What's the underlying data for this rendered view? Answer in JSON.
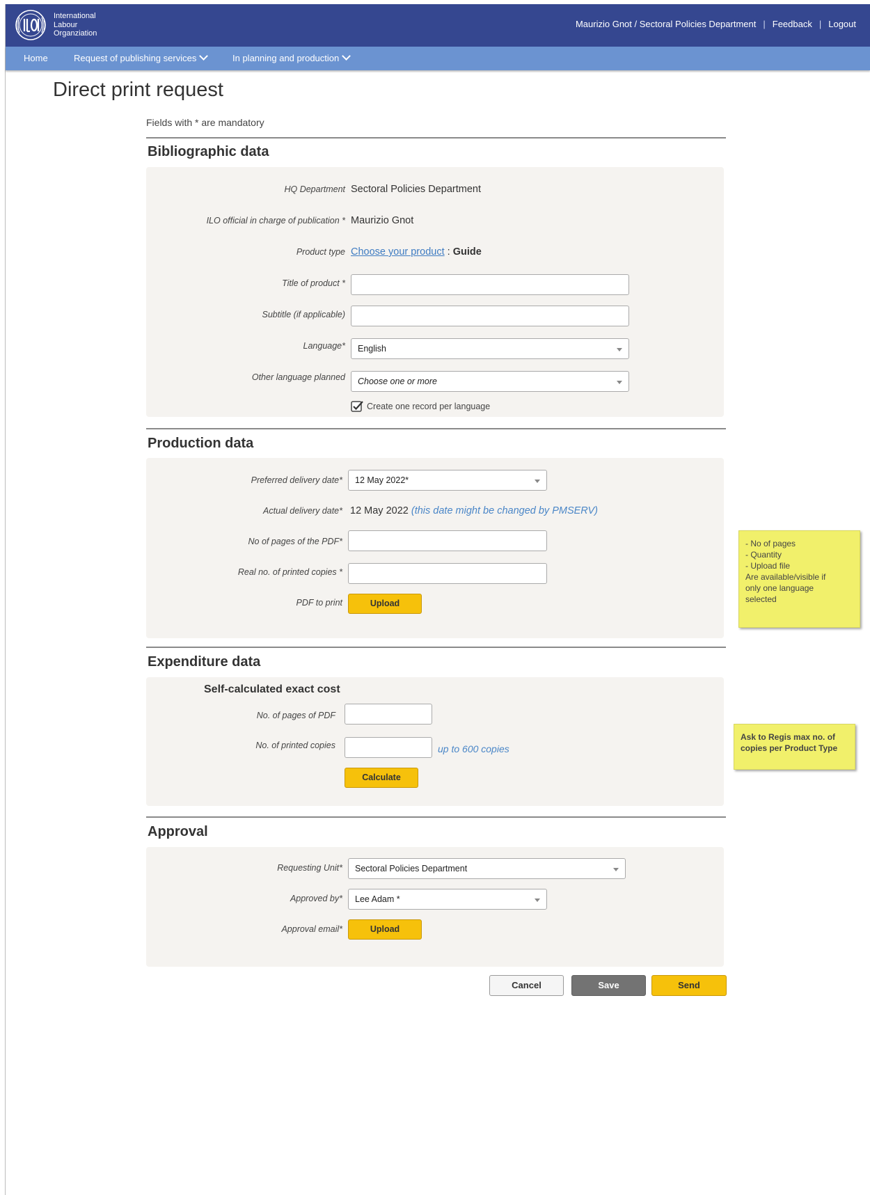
{
  "header": {
    "org_line1": "International",
    "org_line2": "Labour",
    "org_line3": "Organziation",
    "user": "Maurizio Gnot / Sectoral Policies Department",
    "feedback": "Feedback",
    "logout": "Logout",
    "separator": "|"
  },
  "nav": {
    "home": "Home",
    "request": "Request of publishing services",
    "planning": "In planning and production"
  },
  "page": {
    "title": "Direct print request",
    "mandatory_note": "Fields with * are mandatory"
  },
  "bibliographic": {
    "title": "Bibliographic data",
    "hq_label": "HQ Department",
    "hq_value": "Sectoral Policies Department",
    "official_label": "ILO official in charge of publication *",
    "official_value": "Maurizio Gnot",
    "product_label": "Product type",
    "product_link": "Choose your product",
    "product_sep": " : ",
    "product_value": "Guide",
    "title_label": "Title of product *",
    "title_value": "",
    "subtitle_label": "Subtitle (if applicable)",
    "subtitle_value": "",
    "language_label": "Language*",
    "language_value": "English",
    "other_lang_label": "Other language planned",
    "other_lang_placeholder": "Choose one or more",
    "record_checkbox_label": "Create one record per language",
    "record_checked": true
  },
  "production": {
    "title": "Production data",
    "pref_date_label": "Preferred delivery date*",
    "pref_date_value": "12 May 2022*",
    "actual_date_label": "Actual delivery date*",
    "actual_date_value": "12 May 2022",
    "actual_date_note": "(this date might be changed by PMSERV)",
    "pages_label": "No of pages of the PDF*",
    "copies_label": "Real no. of printed copies *",
    "pdf_label": "PDF to print",
    "upload_label": "Upload"
  },
  "expenditure": {
    "title": "Expenditure data",
    "subtitle": "Self-calculated exact cost",
    "pages_label": "No. of  pages of PDF",
    "copies_label": "No. of printed copies",
    "copies_note": "up to 600 copies",
    "calculate_label": "Calculate"
  },
  "approval": {
    "title": "Approval",
    "unit_label": "Requesting Unit*",
    "unit_value": "Sectoral Policies Department",
    "approved_label": "Approved by*",
    "approved_value": "Lee Adam *",
    "email_label": "Approval email*",
    "upload_label": "Upload"
  },
  "actions": {
    "cancel": "Cancel",
    "save": "Save",
    "send": "Send"
  },
  "notes": {
    "note1_lines": [
      "- No of  pages",
      "- Quantity",
      "- Upload file",
      "Are available/visible if",
      "only one language",
      "selected"
    ],
    "note2": "Ask to Regis max no. of copies per Product Type"
  },
  "colors": {
    "header_bg": "#354790",
    "nav_bg": "#6b93d1",
    "button_yellow": "#f6c10b",
    "save_gray": "#737373",
    "panel_bg": "#f5f3f0",
    "sticky_yellow": "#f1f06b",
    "link_blue": "#3f7cc2"
  }
}
